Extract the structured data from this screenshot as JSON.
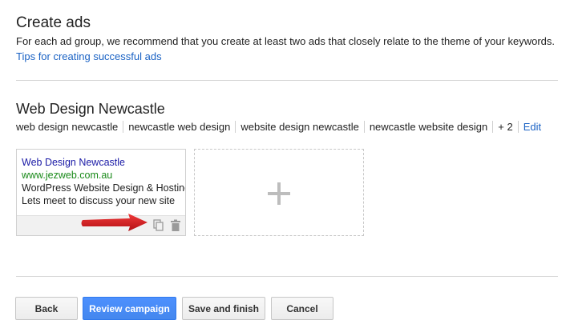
{
  "header": {
    "title": "Create ads",
    "description": "For each ad group, we recommend that you create at least two ads that closely relate to the theme of your keywords.",
    "tips_link": "Tips for creating successful ads"
  },
  "ad_group": {
    "name": "Web Design Newcastle",
    "keywords": [
      "web design newcastle",
      "newcastle web design",
      "website design newcastle",
      "newcastle website design"
    ],
    "more_count": "+ 2",
    "edit_label": "Edit"
  },
  "ad": {
    "headline": "Web Design Newcastle",
    "display_url": "www.jezweb.com.au",
    "line1": "WordPress Website Design & Hosting",
    "line2": "Lets meet to discuss your new site"
  },
  "icons": {
    "copy": "copy-icon",
    "delete": "trash-icon",
    "add": "plus-icon",
    "annotation": "red-arrow"
  },
  "colors": {
    "link": "#1a62c4",
    "ad_title": "#1a1aa6",
    "ad_url": "#1a8a1a",
    "primary_button": "#4d90fe",
    "arrow": "#d8141b"
  },
  "buttons": {
    "back": "Back",
    "review": "Review campaign",
    "save_finish": "Save and finish",
    "cancel": "Cancel"
  }
}
